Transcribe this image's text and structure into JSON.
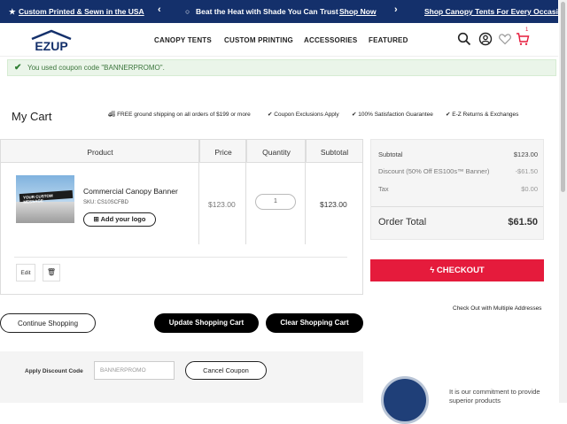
{
  "promo": {
    "left": "Custom Printed & Sewn in the USA",
    "middle": "Beat the Heat with Shade You Can Trust",
    "shop_now": "Shop Now",
    "right": "Shop Canopy Tents For Every Occasion",
    "prev_arrow": "‹",
    "next_arrow": "›"
  },
  "header": {
    "logo": "E-Z UP",
    "menu": [
      "CANOPY TENTS",
      "CUSTOM PRINTING",
      "ACCESSORIES",
      "FEATURED"
    ],
    "cart_count": "1"
  },
  "notice": {
    "text": "You used coupon code \"BANNERPROMO\"."
  },
  "cart": {
    "title": "My Cart",
    "trust": [
      "FREE ground shipping on all orders of $199 or more",
      "Coupon Exclusions Apply",
      "100% Satisfaction Guarantee",
      "E-Z Returns & Exchanges"
    ],
    "columns": [
      "Product",
      "Price",
      "Quantity",
      "Subtotal"
    ],
    "item": {
      "image_text": "YOUR CUSTOM MESSAGE",
      "name": "Commercial Canopy Banner",
      "sku": "SKU: CS10SCFBD",
      "logo_button": "Add your logo",
      "price": "$123.00",
      "qty": "1",
      "subtotal": "$123.00",
      "edit": "Edit"
    },
    "buttons": {
      "continue": "Continue Shopping",
      "update": "Update Shopping Cart",
      "clear": "Clear Shopping Cart"
    }
  },
  "summary": {
    "subtotal_label": "Subtotal",
    "subtotal": "$123.00",
    "discount_label": "Discount (50% Off ES100s™ Banner)",
    "discount": "-$61.50",
    "tax_label": "Tax",
    "tax": "$0.00",
    "total_label": "Order Total",
    "total": "$61.50",
    "checkout": "CHECKOUT",
    "multi": "Check Out with Multiple Addresses"
  },
  "discount": {
    "label": "Apply Discount Code",
    "placeholder": "BANNERPROMO",
    "cancel": "Cancel Coupon"
  },
  "commitment": "It is our commitment to provide superior products",
  "colors": {
    "navy": "#14306b",
    "checkout": "#e51b3c",
    "success_bg": "#eaf5e9"
  }
}
